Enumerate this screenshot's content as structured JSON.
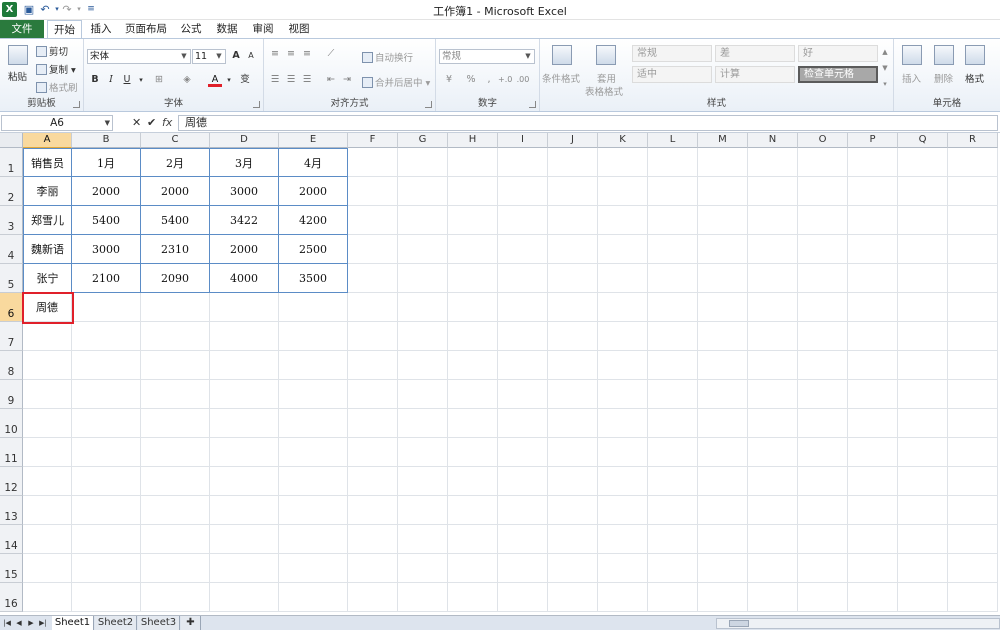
{
  "window": {
    "title": "工作簿1 - Microsoft Excel"
  },
  "ribbon_tabs": [
    "文件",
    "开始",
    "插入",
    "页面布局",
    "公式",
    "数据",
    "审阅",
    "视图"
  ],
  "clipboard": {
    "paste": "粘贴",
    "cut": "剪切",
    "copy": "复制",
    "format_painter": "格式刷",
    "group": "剪贴板"
  },
  "font": {
    "name": "宋体",
    "size": "11",
    "bold": "B",
    "italic": "I",
    "underline": "U",
    "font_color": "A",
    "grow": "A",
    "shrink": "A",
    "pinyin": "变",
    "group": "字体"
  },
  "alignment": {
    "wrap": "自动换行",
    "merge": "合并后居中",
    "group": "对齐方式"
  },
  "number": {
    "format": "常规",
    "percent": "%",
    "comma": ",",
    "group": "数字"
  },
  "styles": {
    "conditional": "条件格式",
    "table_line1": "套用",
    "table_line2": "表格格式",
    "group": "样式",
    "gallery": [
      "常规",
      "差",
      "好",
      "适中",
      "计算",
      "检查单元格"
    ]
  },
  "cells": {
    "insert": "插入",
    "delete": "删除",
    "format": "格式",
    "group": "单元格"
  },
  "formula_bar": {
    "name_box": "A6",
    "fx": "fx",
    "value": "周德"
  },
  "columns": [
    "A",
    "B",
    "C",
    "D",
    "E",
    "F",
    "G",
    "H",
    "I",
    "J",
    "K",
    "L",
    "M",
    "N",
    "O",
    "P",
    "Q",
    "R"
  ],
  "rows": [
    "1",
    "2",
    "3",
    "4",
    "5",
    "6",
    "7",
    "8",
    "9",
    "10",
    "11",
    "12",
    "13",
    "14",
    "15",
    "16"
  ],
  "table": [
    [
      "销售员",
      "1月",
      "2月",
      "3月",
      "4月"
    ],
    [
      "李丽",
      "2000",
      "2000",
      "3000",
      "2000"
    ],
    [
      "郑雪儿",
      "5400",
      "5400",
      "3422",
      "4200"
    ],
    [
      "魏新语",
      "3000",
      "2310",
      "2000",
      "2500"
    ],
    [
      "张宁",
      "2100",
      "2090",
      "4000",
      "3500"
    ]
  ],
  "active_cell": {
    "ref": "A6",
    "value": "周德"
  },
  "sheets": [
    "Sheet1",
    "Sheet2",
    "Sheet3"
  ],
  "colors": {
    "file_tab": "#2a7a3d",
    "selection_border": "#e0202a",
    "table_border": "#5b8cc6",
    "header_selected": "#f9d99e"
  }
}
